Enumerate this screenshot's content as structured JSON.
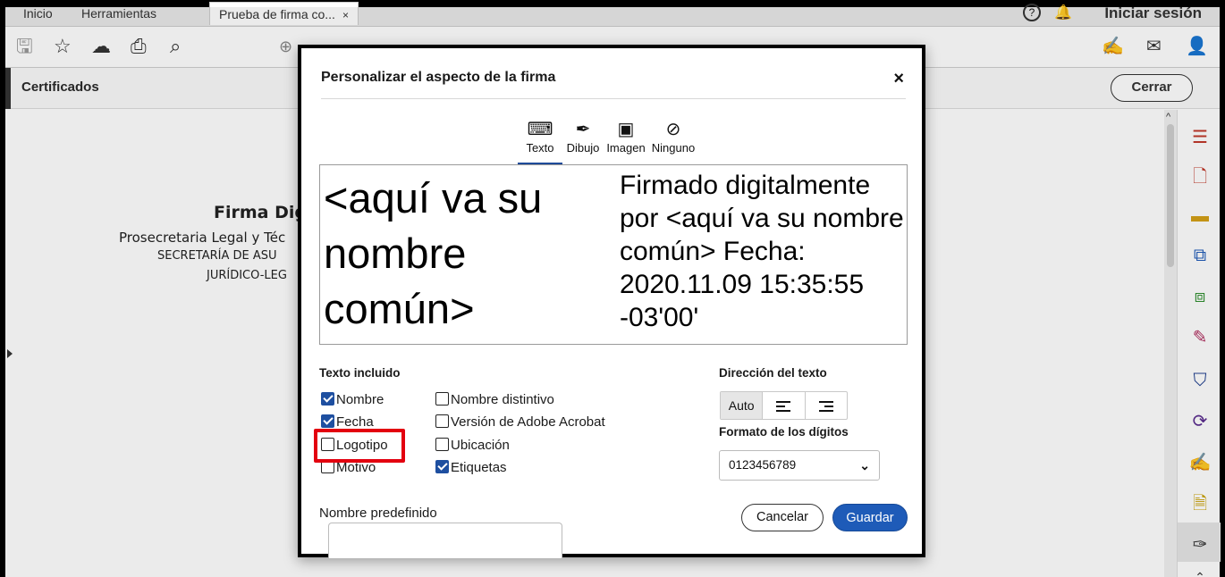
{
  "tabs": {
    "home": "Inicio",
    "tools": "Herramientas",
    "document": "Prueba de firma co...",
    "close_glyph": "×",
    "signin": "Iniciar sesión"
  },
  "cert_bar": {
    "label": "Certificados",
    "close_button": "Cerrar"
  },
  "document": {
    "title": "Firma Dig",
    "line2": "Prosecretaria Legal y Téc",
    "line3": "SECRETARÍA DE ASU",
    "line4": "JURÍDICO-LEG"
  },
  "dialog": {
    "title": "Personalizar el aspecto de la firma",
    "close": "×",
    "modes": [
      {
        "label": "Texto",
        "icon": "keyboard-icon",
        "active": true
      },
      {
        "label": "Dibujo",
        "icon": "pen-draw-icon",
        "active": false
      },
      {
        "label": "Imagen",
        "icon": "image-icon",
        "active": false
      },
      {
        "label": "Ninguno",
        "icon": "none-icon",
        "active": false
      }
    ],
    "preview": {
      "name": "<aquí va su nombre común>",
      "details": "Firmado digitalmente por <aquí va su nombre común> Fecha: 2020.11.09 15:35:55 -03'00'"
    },
    "included_text": {
      "label": "Texto incluido",
      "options": [
        {
          "label": "Nombre",
          "checked": true
        },
        {
          "label": "Fecha",
          "checked": true
        },
        {
          "label": "Logotipo",
          "checked": false
        },
        {
          "label": "Motivo",
          "checked": false
        },
        {
          "label": "Nombre distintivo",
          "checked": false
        },
        {
          "label": "Versión de Adobe Acrobat",
          "checked": false
        },
        {
          "label": "Ubicación",
          "checked": false
        },
        {
          "label": "Etiquetas",
          "checked": true
        }
      ]
    },
    "text_direction": {
      "label": "Dirección del texto",
      "auto": "Auto",
      "selected": "Auto"
    },
    "digit_format": {
      "label": "Formato de los dígitos",
      "value": "0123456789"
    },
    "predefined_name_label": "Nombre predefinido",
    "cancel": "Cancelar",
    "save": "Guardar",
    "highlight_color": "#e3000f",
    "accent_color": "#1e5bb8"
  }
}
